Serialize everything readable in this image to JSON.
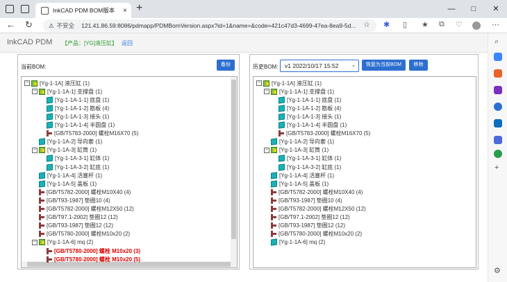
{
  "browser": {
    "tab_title": "InkCAD PDM BOM版本",
    "tab_close": "×",
    "new_tab": "+",
    "security_label": "不安全",
    "url": "121.41.86.59:8086/pdmapp/PDMBomVersion.aspx?id=1&name=&code=421c47d3-4699-47ea-8ea9-5d...",
    "back": "←",
    "refresh": "↻",
    "win_min": "—",
    "win_max": "□",
    "win_close": "✕"
  },
  "header": {
    "brand": "InkCAD PDM",
    "product": "【产品：[YG]液压缸】",
    "back_link": "返回"
  },
  "left_panel": {
    "label": "当前BOM:",
    "backup_button": "备份",
    "tree": [
      {
        "type": "asm",
        "toggle": "−",
        "text": "[Yg-1-1A] 液压缸 (1)"
      },
      {
        "type": "asm",
        "toggle": "−",
        "text": "[Yg-1-1A-1] 支撑盘 (1)"
      },
      {
        "type": "part",
        "toggle": "",
        "text": "[Yg-1-1A-1-1] 底盘 (1)"
      },
      {
        "type": "part",
        "toggle": "",
        "text": "[Yg-1-1A-1-2] 筋板 (4)"
      },
      {
        "type": "part",
        "toggle": "",
        "text": "[Yg-1-1A-1-3] 接头 (1)"
      },
      {
        "type": "part",
        "toggle": "",
        "text": "[Yg-1-1A-1-4] 半圆盘 (1)"
      },
      {
        "type": "std",
        "toggle": "",
        "text": "[GB/T5783-2000] 螺栓M16X70 (5)"
      },
      {
        "type": "part",
        "toggle": "",
        "text": "[Yg-1-1A-2] 导向套 (1)"
      },
      {
        "type": "asm",
        "toggle": "−",
        "text": "[Yg-1-1A-3] 缸筒 (1)"
      },
      {
        "type": "part",
        "toggle": "",
        "text": "[Yg-1-1A-3-1] 缸体 (1)"
      },
      {
        "type": "part",
        "toggle": "",
        "text": "[Yg-1-1A-3-2] 缸底 (1)"
      },
      {
        "type": "part",
        "toggle": "",
        "text": "[Yg-1-1A-4] 活塞杆 (1)"
      },
      {
        "type": "part",
        "toggle": "",
        "text": "[Yg-1-1A-5] 盖板 (1)"
      },
      {
        "type": "std",
        "toggle": "",
        "text": "[GB/T5782-2000] 螺栓M10X40 (4)"
      },
      {
        "type": "std",
        "toggle": "",
        "text": "[GB/T93-1987] 垫圈10 (4)"
      },
      {
        "type": "std",
        "toggle": "",
        "text": "[GB/T5782-2000] 螺栓M12X50 (12)"
      },
      {
        "type": "std",
        "toggle": "",
        "text": "[GB/T97.1-2002] 垫圈12 (12)"
      },
      {
        "type": "std",
        "toggle": "",
        "text": "[GB/T93-1987] 垫圈12 (12)"
      },
      {
        "type": "std",
        "toggle": "",
        "text": "[GB/T5780-2000] 螺栓M10x20 (2)"
      },
      {
        "type": "asm",
        "toggle": "−",
        "text": "[Yg-1-1A-6] mq (2)"
      },
      {
        "type": "std",
        "toggle": "",
        "text": "[GB/T5780-2000] 螺栓 M10x20 (3)",
        "highlight": true
      },
      {
        "type": "std",
        "toggle": "",
        "text": "[GB/T5780-2000] 螺栓 M10x20 (5)",
        "highlight": true
      }
    ]
  },
  "right_panel": {
    "label": "历史BOM:",
    "selected_version": "v1  2022/10/17 15:52",
    "restore_button": "恢复为当前BOM",
    "remove_button": "移除",
    "tree": [
      {
        "type": "asm",
        "toggle": "−",
        "text": "[Yg-1-1A] 液压缸 (1)"
      },
      {
        "type": "asm",
        "toggle": "−",
        "text": "[Yg-1-1A-1] 支撑盘 (1)"
      },
      {
        "type": "part",
        "toggle": "",
        "text": "[Yg-1-1A-1-1] 底盘 (1)"
      },
      {
        "type": "part",
        "toggle": "",
        "text": "[Yg-1-1A-1-2] 筋板 (4)"
      },
      {
        "type": "part",
        "toggle": "",
        "text": "[Yg-1-1A-1-3] 接头 (1)"
      },
      {
        "type": "part",
        "toggle": "",
        "text": "[Yg-1-1A-1-4] 半圆盘 (1)"
      },
      {
        "type": "std",
        "toggle": "",
        "text": "[GB/T5783-2000] 螺栓M16X70 (5)"
      },
      {
        "type": "part",
        "toggle": "",
        "text": "[Yg-1-1A-2] 导向套 (1)"
      },
      {
        "type": "asm",
        "toggle": "−",
        "text": "[Yg-1-1A-3] 缸筒 (1)"
      },
      {
        "type": "part",
        "toggle": "",
        "text": "[Yg-1-1A-3-1] 缸体 (1)"
      },
      {
        "type": "part",
        "toggle": "",
        "text": "[Yg-1-1A-3-2] 缸底 (1)"
      },
      {
        "type": "part",
        "toggle": "",
        "text": "[Yg-1-1A-4] 活塞杆 (1)"
      },
      {
        "type": "part",
        "toggle": "",
        "text": "[Yg-1-1A-5] 盖板 (1)"
      },
      {
        "type": "std",
        "toggle": "",
        "text": "[GB/T5782-2000] 螺栓M10X40 (4)"
      },
      {
        "type": "std",
        "toggle": "",
        "text": "[GB/T93-1987] 垫圈10 (4)"
      },
      {
        "type": "std",
        "toggle": "",
        "text": "[GB/T5782-2000] 螺栓M12X50 (12)"
      },
      {
        "type": "std",
        "toggle": "",
        "text": "[GB/T97.1-2002] 垫圈12 (12)"
      },
      {
        "type": "std",
        "toggle": "",
        "text": "[GB/T93-1987] 垫圈12 (12)"
      },
      {
        "type": "std",
        "toggle": "",
        "text": "[GB/T5780-2000] 螺栓M10x20 (2)"
      },
      {
        "type": "part",
        "toggle": "",
        "text": "[Yg-1-1A-6] mq (2)"
      }
    ]
  },
  "colors": {
    "accent": "#2d6fcf",
    "product_green": "#2a9d2a",
    "highlight_red": "#e00000"
  },
  "icons": {
    "assembly": "assembly-cube-icon",
    "part": "part-cube-icon",
    "standard": "standard-part-icon"
  }
}
